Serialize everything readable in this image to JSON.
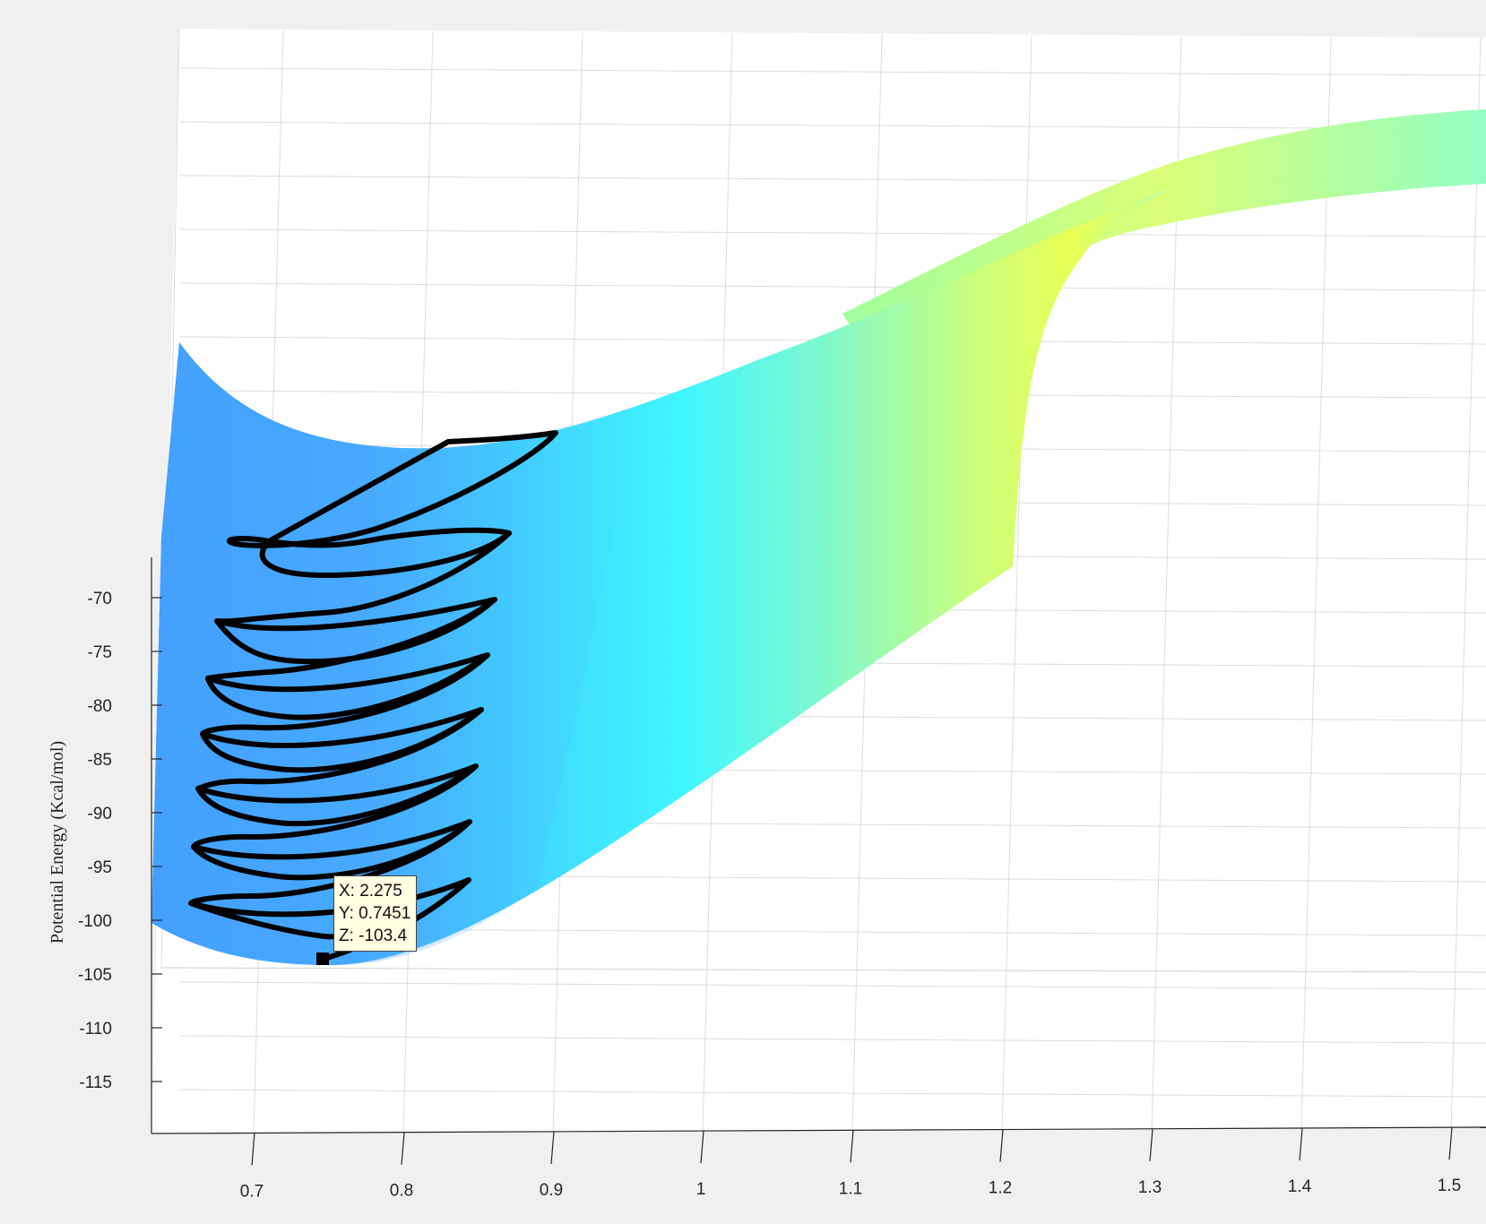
{
  "chart_data": {
    "type": "surface",
    "ylabel": "Potential Energy (Kcal/mol)",
    "zlim": [
      -120,
      -60
    ],
    "x_ticks": [
      "0.7",
      "0.8",
      "0.9",
      "1",
      "1.1",
      "1.2",
      "1.3",
      "1.4",
      "1.5"
    ],
    "z_ticks": [
      "-70",
      "-75",
      "-80",
      "-85",
      "-90",
      "-95",
      "-100",
      "-105",
      "-110",
      "-115"
    ],
    "colormap": [
      "#4aa6ff",
      "#3ff6ff",
      "#e9ff55"
    ],
    "trajectory_color": "#000000",
    "datatip": {
      "x": "X: 2.275",
      "y": "Y: 0.7451",
      "z": "Z: -103.4"
    }
  }
}
